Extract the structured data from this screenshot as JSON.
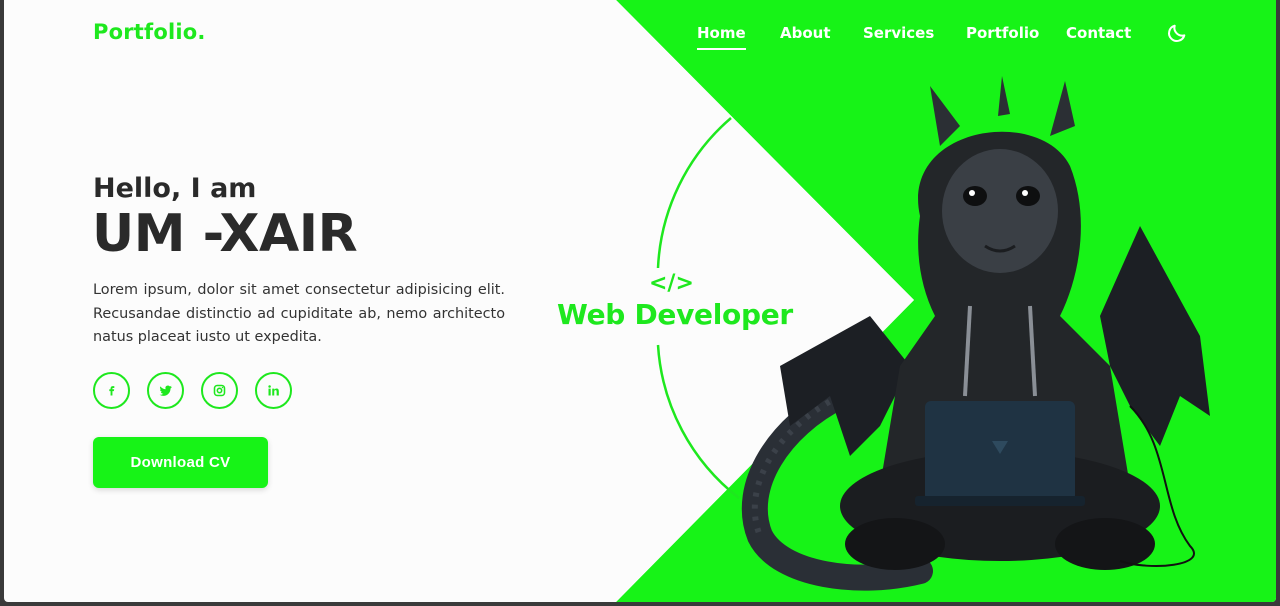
{
  "colors": {
    "accent": "#1ee81e",
    "button": "#17f317",
    "text_dark": "#2a2a2a",
    "background": "#fcfcfc"
  },
  "brand": {
    "logo": "Portfolio."
  },
  "nav": {
    "items": [
      {
        "label": "Home",
        "active": true
      },
      {
        "label": "About",
        "active": false
      },
      {
        "label": "Services",
        "active": false
      },
      {
        "label": "Portfolio",
        "active": false
      },
      {
        "label": "Contact",
        "active": false
      }
    ],
    "theme_toggle_icon": "moon-icon"
  },
  "hero": {
    "greeting": "Hello, I am",
    "name": "UM -XAIR",
    "description": "Lorem ipsum, dolor sit amet consectetur adipisicing elit. Recusandae distinctio ad cupiditate ab, nemo architecto natus placeat iusto ut expedita.",
    "socials": [
      {
        "icon": "facebook-icon",
        "glyph": "f"
      },
      {
        "icon": "twitter-icon"
      },
      {
        "icon": "instagram-icon"
      },
      {
        "icon": "linkedin-icon",
        "glyph": "in"
      }
    ],
    "cta_label": "Download CV"
  },
  "badge": {
    "code_icon": "</>",
    "role": "Web Developer"
  },
  "illustration": {
    "name": "hooded-dragon-with-laptop"
  }
}
